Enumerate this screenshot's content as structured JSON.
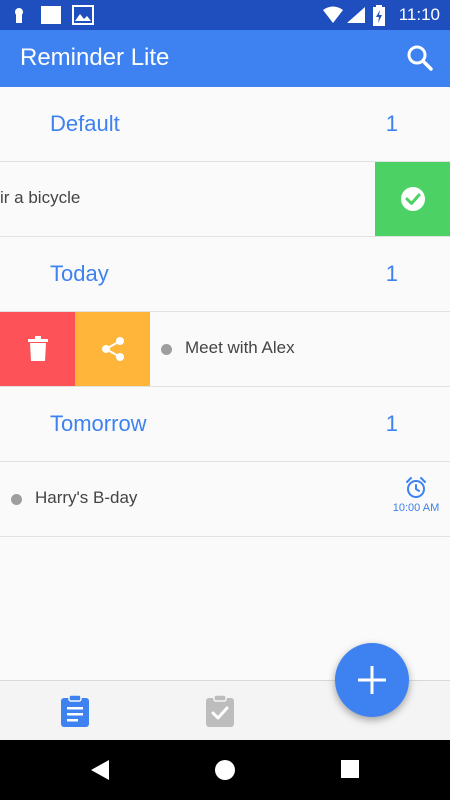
{
  "app": {
    "title": "Reminder Lite"
  },
  "status_bar": {
    "time": "11:10"
  },
  "groups": [
    {
      "title": "Default",
      "count": "1"
    },
    {
      "title": "Today",
      "count": "1"
    },
    {
      "title": "Tomorrow",
      "count": "1"
    }
  ],
  "tasks": [
    {
      "text": "ir a bicycle"
    },
    {
      "text": "Meet with Alex"
    },
    {
      "text": "Harry's B-day",
      "alarm_time": "10:00 AM"
    }
  ],
  "colors": {
    "primary": "#3d82f0",
    "done": "#4cd264",
    "delete": "#fd5257",
    "share": "#ffb43a"
  },
  "icons": [
    "search-icon",
    "check-icon",
    "trash-icon",
    "share-icon",
    "alarm-icon",
    "clipboard-list-icon",
    "clipboard-check-icon",
    "plus-icon"
  ]
}
